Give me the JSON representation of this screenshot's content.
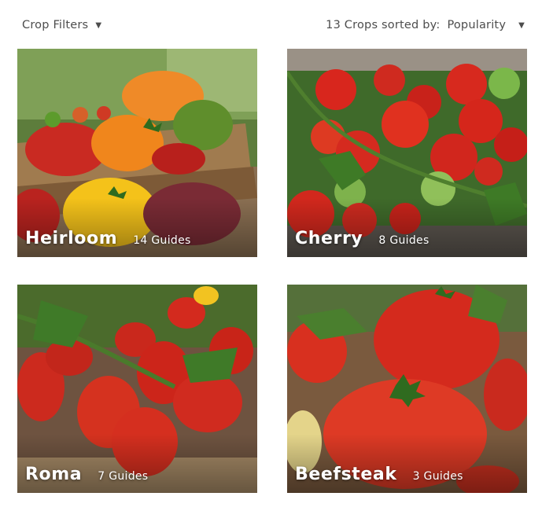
{
  "header": {
    "filter_label": "Crop Filters",
    "count_text": "13 Crops sorted by:",
    "sort_value": "Popularity",
    "caret": "▼"
  },
  "crops": [
    {
      "name": "Heirloom",
      "guides": "14 Guides"
    },
    {
      "name": "Cherry",
      "guides": "8 Guides"
    },
    {
      "name": "Roma",
      "guides": "7 Guides"
    },
    {
      "name": "Beefsteak",
      "guides": "3 Guides"
    }
  ]
}
